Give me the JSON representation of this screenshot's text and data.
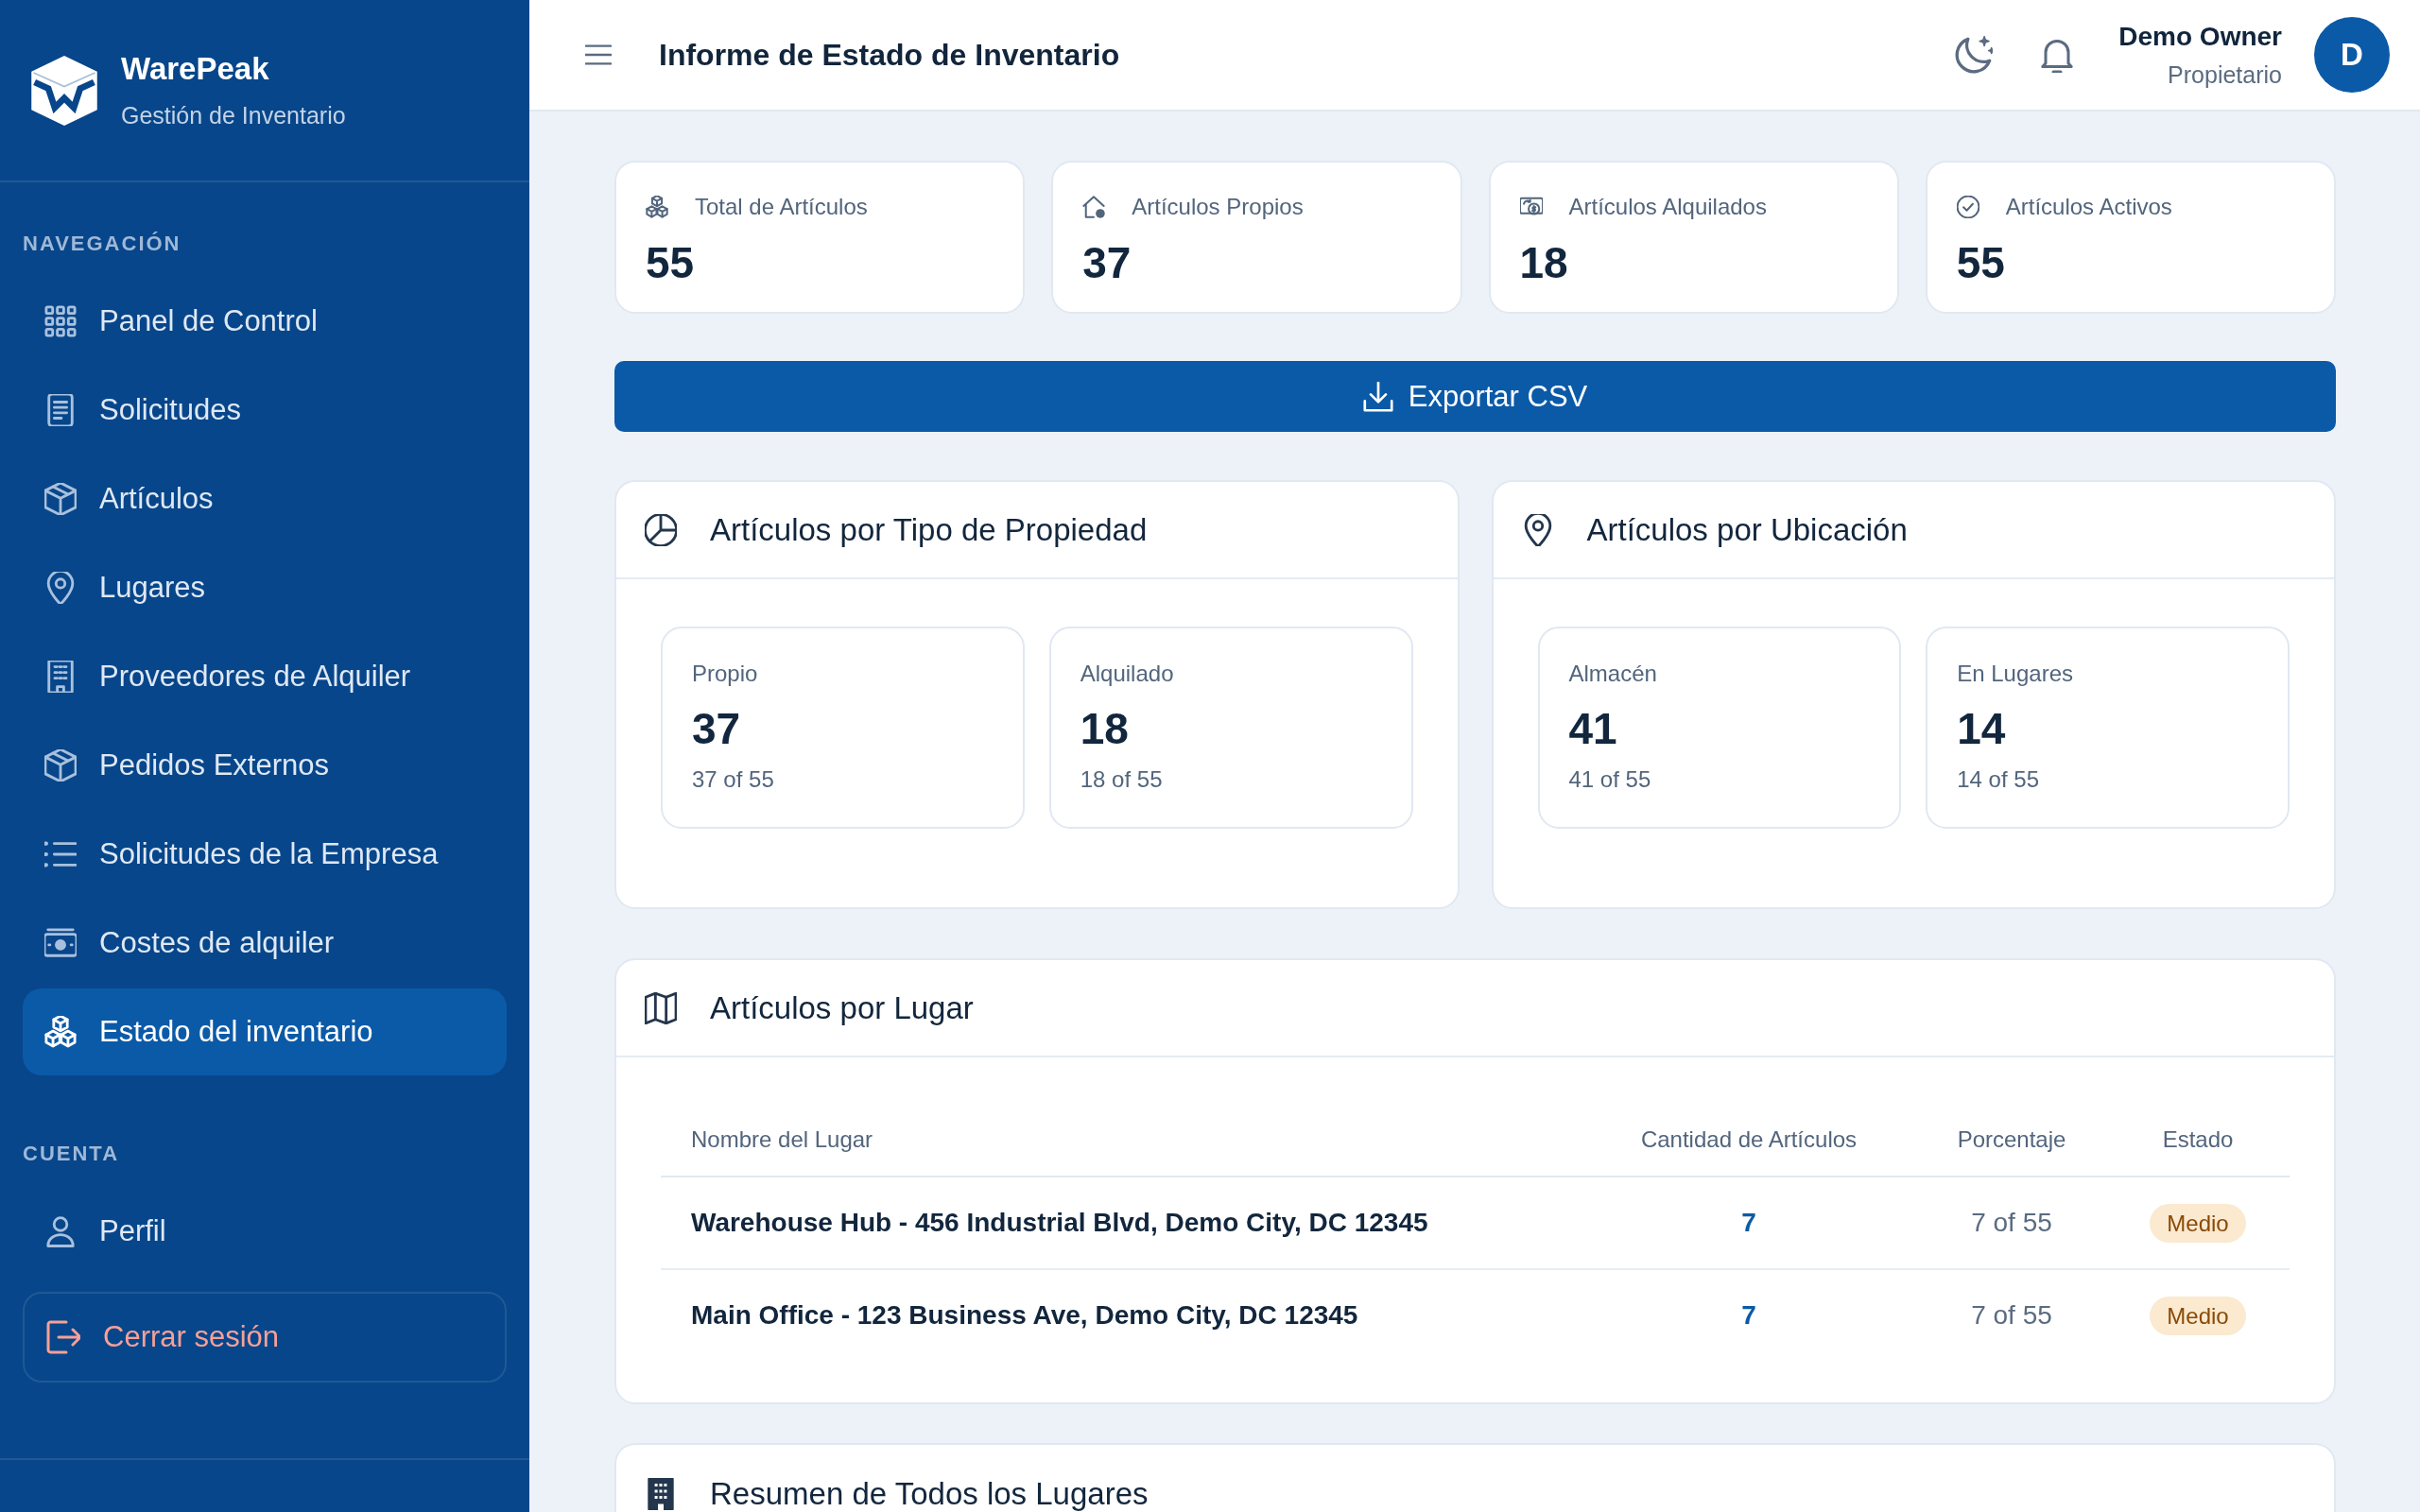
{
  "sidebar": {
    "brand": {
      "name": "WarePeak",
      "tagline": "Gestión de Inventario"
    },
    "sections": [
      {
        "heading": "NAVEGACIÓN",
        "items": [
          {
            "label": "Panel de Control",
            "selected": false
          },
          {
            "label": "Solicitudes",
            "selected": false
          },
          {
            "label": "Artículos",
            "selected": false
          },
          {
            "label": "Lugares",
            "selected": false
          },
          {
            "label": "Proveedores de Alquiler",
            "selected": false
          },
          {
            "label": "Pedidos Externos",
            "selected": false
          },
          {
            "label": "Solicitudes de la Empresa",
            "selected": false
          },
          {
            "label": "Costes de alquiler",
            "selected": false
          },
          {
            "label": "Estado del inventario",
            "selected": true
          }
        ]
      },
      {
        "heading": "CUENTA",
        "items": [
          {
            "label": "Perfil",
            "selected": false
          }
        ]
      }
    ],
    "logout_button": "Cerrar sesión"
  },
  "header": {
    "title": "Informe de Estado de Inventario",
    "user": {
      "name": "Demo Owner",
      "role": "Propietario",
      "avatar_initial": "D"
    }
  },
  "stat_cards": [
    {
      "label": "Total de Artículos",
      "value": "55"
    },
    {
      "label": "Artículos Propios",
      "value": "37"
    },
    {
      "label": "Artículos Alquilados",
      "value": "18"
    },
    {
      "label": "Artículos Activos",
      "value": "55"
    }
  ],
  "export_button": "Exportar CSV",
  "breakdown_panels": [
    {
      "title": "Artículos por Tipo de Propiedad",
      "tiles": [
        {
          "label": "Propio",
          "value": "37",
          "detail": "37 of 55"
        },
        {
          "label": "Alquilado",
          "value": "18",
          "detail": "18 of 55"
        }
      ]
    },
    {
      "title": "Artículos por Ubicación",
      "tiles": [
        {
          "label": "Almacén",
          "value": "41",
          "detail": "41 of 55"
        },
        {
          "label": "En Lugares",
          "value": "14",
          "detail": "14 of 55"
        }
      ]
    }
  ],
  "places_panel": {
    "title": "Artículos por Lugar",
    "table": {
      "columns": [
        "Nombre del Lugar",
        "Cantidad de Artículos",
        "Porcentaje",
        "Estado"
      ],
      "rows": [
        {
          "place": "Warehouse Hub - 456 Industrial Blvd, Demo City, DC 12345",
          "count": "7",
          "share": "7 of 55",
          "status": "Medio"
        },
        {
          "place": "Main Office - 123 Business Ave, Demo City, DC 12345",
          "count": "7",
          "share": "7 of 55",
          "status": "Medio"
        }
      ]
    }
  },
  "summary_panel": {
    "title": "Resumen de Todos los Lugares"
  }
}
